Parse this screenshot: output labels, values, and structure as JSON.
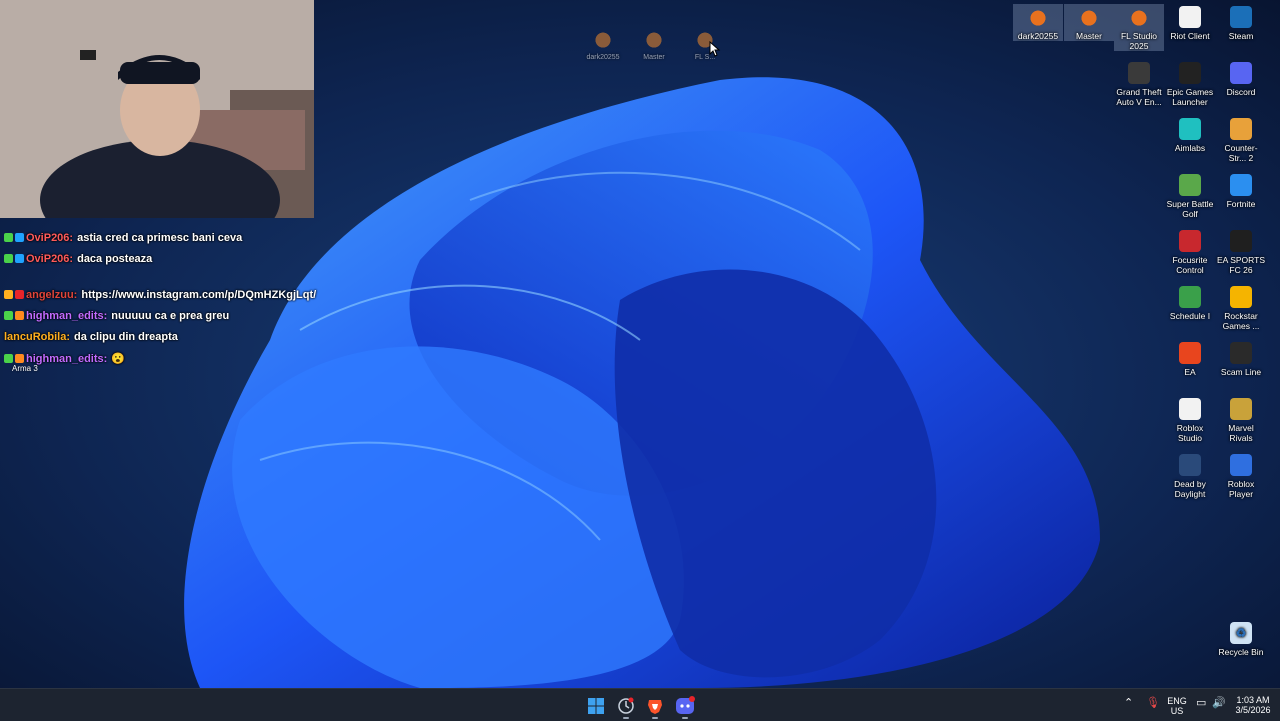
{
  "chat": {
    "messages": [
      {
        "user": "OviP206:",
        "user_color": "#ff5a5a",
        "text": "astia cred ca primesc bani ceva"
      },
      {
        "user": "OviP206:",
        "user_color": "#ff5a5a",
        "text": "daca posteaza"
      },
      {
        "user": "angelzuu:",
        "user_color": "#e0443a",
        "text": "https://www.instagram.com/p/DQmHZKgjLqt/"
      },
      {
        "user": "highman_edits:",
        "user_color": "#c26bff",
        "text": "nuuuuu ca e prea greu"
      },
      {
        "user": "lancuRobila:",
        "user_color": "#ffb020",
        "text": "da clipu din dreapta"
      },
      {
        "user": "highman_edits:",
        "user_color": "#c26bff",
        "text": "😮"
      }
    ],
    "overlay_label": "Arma 3"
  },
  "top_center_icons": [
    {
      "label": "dark20255"
    },
    {
      "label": "Master"
    },
    {
      "label": "FL S..."
    }
  ],
  "desktop_icons": [
    {
      "label": "dark20255",
      "icon": "fl-studio-icon",
      "color": "#e8711e"
    },
    {
      "label": "Master",
      "icon": "fl-studio-icon",
      "color": "#e8711e"
    },
    {
      "label": "FL Studio 2025",
      "icon": "fl-studio-icon",
      "color": "#e8711e"
    },
    {
      "label": "Riot Client",
      "icon": "file-icon",
      "color": "#f2f2f2"
    },
    {
      "label": "Steam",
      "icon": "steam-icon",
      "color": "#1b6fb8"
    },
    {
      "label": "Grand Theft Auto V En...",
      "icon": "gta-icon",
      "color": "#3a3a3a"
    },
    {
      "label": "Epic Games Launcher",
      "icon": "epic-games-icon",
      "color": "#222222"
    },
    {
      "label": "Discord",
      "icon": "discord-icon",
      "color": "#5865f2"
    },
    {
      "label": "Aimlabs",
      "icon": "aimlabs-icon",
      "color": "#1fc0c0"
    },
    {
      "label": "Counter-Str... 2",
      "icon": "cs2-icon",
      "color": "#e8a13a"
    },
    {
      "label": "Super Battle Golf",
      "icon": "golf-icon",
      "color": "#5aa84a"
    },
    {
      "label": "Fortnite",
      "icon": "fortnite-icon",
      "color": "#2b8ff0"
    },
    {
      "label": "Focusrite Control",
      "icon": "focusrite-icon",
      "color": "#c8282e"
    },
    {
      "label": "EA SPORTS FC 26",
      "icon": "fc26-icon",
      "color": "#1f1f1f"
    },
    {
      "label": "Schedule I",
      "icon": "schedule-icon",
      "color": "#3aa04a"
    },
    {
      "label": "Rockstar Games ...",
      "icon": "rockstar-icon",
      "color": "#f5b400"
    },
    {
      "label": "EA",
      "icon": "ea-icon",
      "color": "#e8451e"
    },
    {
      "label": "Scam Line",
      "icon": "scam-line-icon",
      "color": "#2a2a2a"
    },
    {
      "label": "Roblox Studio",
      "icon": "roblox-studio-icon",
      "color": "#f2f2f2"
    },
    {
      "label": "Marvel Rivals",
      "icon": "marvel-rivals-icon",
      "color": "#c9a23a"
    },
    {
      "label": "Dead by Daylight",
      "icon": "dbd-icon",
      "color": "#2a4a7a"
    },
    {
      "label": "Roblox Player",
      "icon": "roblox-player-icon",
      "color": "#2f6fe0"
    }
  ],
  "recycle_bin": {
    "label": "Recycle Bin"
  },
  "taskbar": {
    "apps": [
      {
        "name": "start-button",
        "icon": "windows-icon",
        "color": "#3ea2f0"
      },
      {
        "name": "taskbar-app-timer",
        "icon": "clock-icon",
        "color": "#9aa6b8"
      },
      {
        "name": "taskbar-app-brave",
        "icon": "brave-icon",
        "color": "#fb542b"
      },
      {
        "name": "taskbar-app-discord",
        "icon": "discord-icon",
        "color": "#5865f2"
      }
    ],
    "discord_badge": "",
    "lang_line1": "ENG",
    "lang_line2": "US",
    "time": "1:03 AM",
    "date": "3/5/2026"
  }
}
